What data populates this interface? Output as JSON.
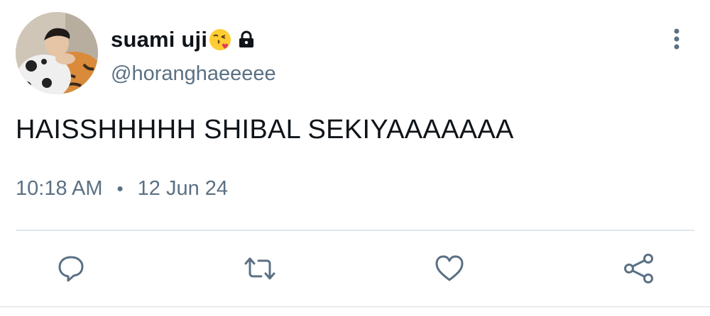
{
  "user": {
    "display_name": "suami uji",
    "emoji_icon": "face-blowing-a-kiss-emoji",
    "lock_icon": "lock-icon",
    "handle": "@horanghaeeeee"
  },
  "tweet": {
    "text": "HAISSHHHHH SHIBAL SEKIYAAAAAAA",
    "time": "10:18 AM",
    "separator": "•",
    "date": "12 Jun 24"
  },
  "actions": {
    "reply_icon": "reply-icon",
    "retweet_icon": "retweet-icon",
    "like_icon": "heart-icon",
    "share_icon": "share-icon"
  },
  "colors": {
    "text_primary": "#0f1419",
    "text_secondary": "#5b7083",
    "icon_color": "#5b7083",
    "divider": "#e1e8ed"
  }
}
